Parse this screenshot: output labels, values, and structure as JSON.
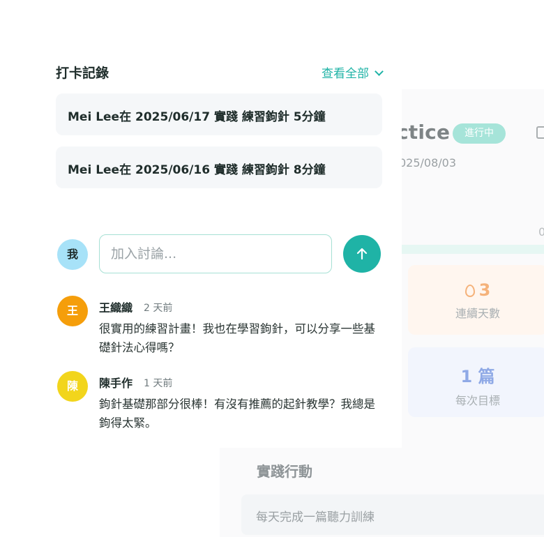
{
  "background_card": {
    "title": "ctice",
    "status_badge": "進行中",
    "date": "025/08/03",
    "progress_value": "0",
    "stats": [
      {
        "value": "3",
        "label": "連續天數",
        "icon": "flame-icon",
        "color": "#f5b27a"
      },
      {
        "value": "1 篇",
        "label": "每次目標",
        "color": "#8fa9e6"
      }
    ],
    "section_title": "實踐行動",
    "action_item": "每天完成一篇聽力訓練"
  },
  "checkin": {
    "title": "打卡記錄",
    "view_all": "查看全部",
    "records": [
      {
        "text": "Mei Lee在 2025/06/17 實踐 練習鉤針 5分鐘"
      },
      {
        "text": "Mei Lee在 2025/06/16 實踐 練習鉤針 8分鐘"
      }
    ]
  },
  "discussion": {
    "my_avatar": "我",
    "input_placeholder": "加入討論...",
    "send_icon": "arrow-up-icon",
    "accent_color": "#1fb3a6",
    "comments": [
      {
        "avatar": "王",
        "avatar_color": "#f59e0b",
        "name": "王織織",
        "time": "2 天前",
        "text": "很實用的練習計畫！我也在學習鉤針，可以分享一些基礎針法心得嗎？"
      },
      {
        "avatar": "陳",
        "avatar_color": "#f2d51c",
        "name": "陳手作",
        "time": "1 天前",
        "text": "鉤針基礎那部分很棒！有沒有推薦的起針教學？我總是鉤得太緊。"
      }
    ]
  }
}
